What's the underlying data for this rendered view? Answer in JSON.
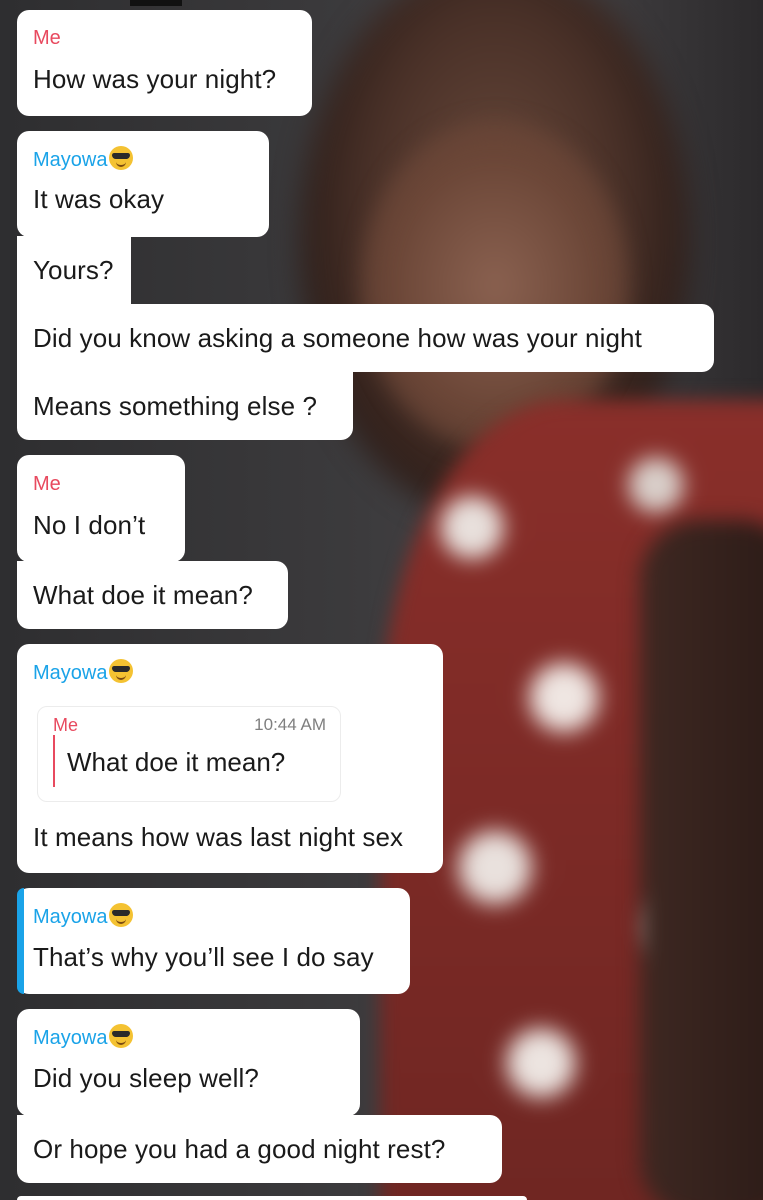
{
  "messages": [
    {
      "sender": "Me",
      "sender_type": "me",
      "lines": [
        "How was your night?"
      ]
    },
    {
      "sender": "Mayowa",
      "sender_type": "them",
      "emoji": "smiling-face-with-sunglasses",
      "lines": [
        "It was okay",
        "Yours?",
        "Did you know asking a someone how was your night",
        "Means something else ?"
      ]
    },
    {
      "sender": "Me",
      "sender_type": "me",
      "lines": [
        "No I don’t",
        "What doe it mean?"
      ]
    },
    {
      "sender": "Mayowa",
      "sender_type": "them",
      "emoji": "smiling-face-with-sunglasses",
      "quote": {
        "sender": "Me",
        "time": "10:44 AM",
        "text": "What doe it mean?"
      },
      "lines": [
        "It means how was last night sex"
      ]
    },
    {
      "sender": "Mayowa",
      "sender_type": "them",
      "emoji": "smiling-face-with-sunglasses",
      "highlighted": true,
      "lines": [
        "That’s why you’ll see I do say"
      ]
    },
    {
      "sender": "Mayowa",
      "sender_type": "them",
      "emoji": "smiling-face-with-sunglasses",
      "lines": [
        "Did you sleep well?",
        "Or hope you had a good night rest?"
      ]
    }
  ],
  "colors": {
    "me_name": "#e84a5f",
    "them_name": "#1aa3e8",
    "bubble_bg": "#ffffff",
    "highlight_accent": "#1aa3e8"
  }
}
